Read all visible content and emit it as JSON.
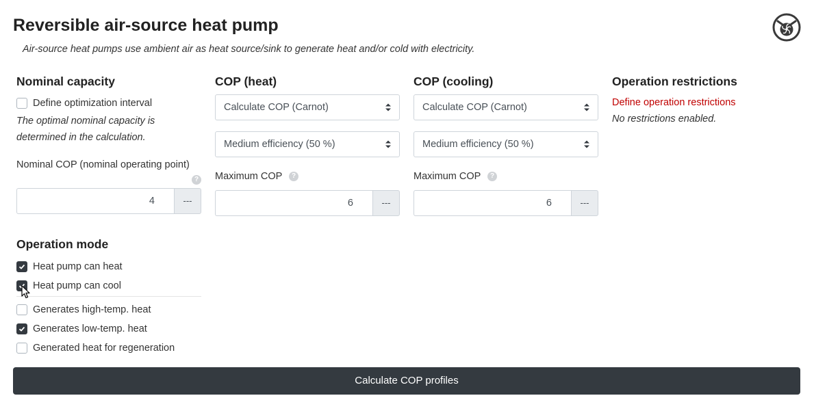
{
  "header": {
    "title": "Reversible air-source heat pump",
    "subtitle": "Air-source heat pumps use ambient air as heat source/sink to generate heat and/or cold with electricity."
  },
  "nominal_capacity": {
    "title": "Nominal capacity",
    "optimization_label": "Define optimization interval",
    "optimization_checked": false,
    "note": "The optimal nominal capacity is determined in the calculation.",
    "nominal_cop_label": "Nominal COP (nominal operating point)",
    "nominal_cop_value": "4",
    "nominal_cop_addon": "---"
  },
  "operation_mode": {
    "title": "Operation mode",
    "items": [
      {
        "label": "Heat pump can heat",
        "checked": true
      },
      {
        "label": "Heat pump can cool",
        "checked": true
      },
      {
        "label": "Generates high-temp. heat",
        "checked": false
      },
      {
        "label": "Generates low-temp. heat",
        "checked": true
      },
      {
        "label": "Generated heat for regeneration",
        "checked": false
      }
    ]
  },
  "cop_heat": {
    "title": "COP (heat)",
    "method": "Calculate COP (Carnot)",
    "efficiency": "Medium efficiency (50 %)",
    "max_label": "Maximum COP",
    "max_value": "6",
    "max_addon": "---"
  },
  "cop_cooling": {
    "title": "COP (cooling)",
    "method": "Calculate COP (Carnot)",
    "efficiency": "Medium efficiency (50 %)",
    "max_label": "Maximum COP",
    "max_value": "6",
    "max_addon": "---"
  },
  "restrictions": {
    "title": "Operation restrictions",
    "link": "Define operation restrictions",
    "status": "No restrictions enabled."
  },
  "footer": {
    "button_label": "Calculate COP profiles"
  },
  "icons": {
    "logo": "fan-logo-icon",
    "help": "question-circle-icon",
    "select_arrows": "sort-arrows-icon",
    "checkmark": "check-icon",
    "cursor": "mouse-pointer-icon"
  },
  "colors": {
    "dark_accent": "#343a40",
    "link_red": "#c00000",
    "addon_bg": "#e9ecef"
  }
}
